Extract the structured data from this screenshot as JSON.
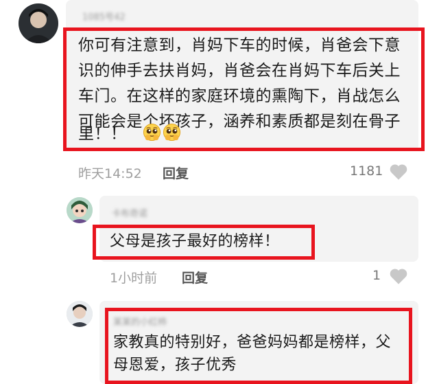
{
  "comments": [
    {
      "username": "1085号42",
      "lines": [
        "你可有注意到，肖妈下车的时候，肖爸会下意",
        "识的伸手去扶肖妈，肖爸会在肖妈下车后关上",
        "车门。在这样的家庭环境的熏陶下，肖战怎么",
        "可能会是个坏孩子，涵养和素质都是刻在骨子",
        "里！！"
      ],
      "emoji": [
        "pleading-face-icon",
        "pleading-face-icon"
      ],
      "time": "昨天14:52",
      "reply_label": "回复",
      "likes": "1181"
    },
    {
      "username": "卡布奇诺",
      "lines": [
        "父母是孩子最好的榜样！"
      ],
      "time": "1小时前",
      "reply_label": "回复",
      "likes": "1"
    },
    {
      "username": "某某的小红柿",
      "lines": [
        "家教真的特别好，爸爸妈妈都是榜样，父",
        "母恩爱，孩子优秀"
      ]
    }
  ],
  "colors": {
    "highlight_border": "#e8141e",
    "bubble_bg": "#f3f3f3",
    "meta_text": "#9e9e9e"
  }
}
